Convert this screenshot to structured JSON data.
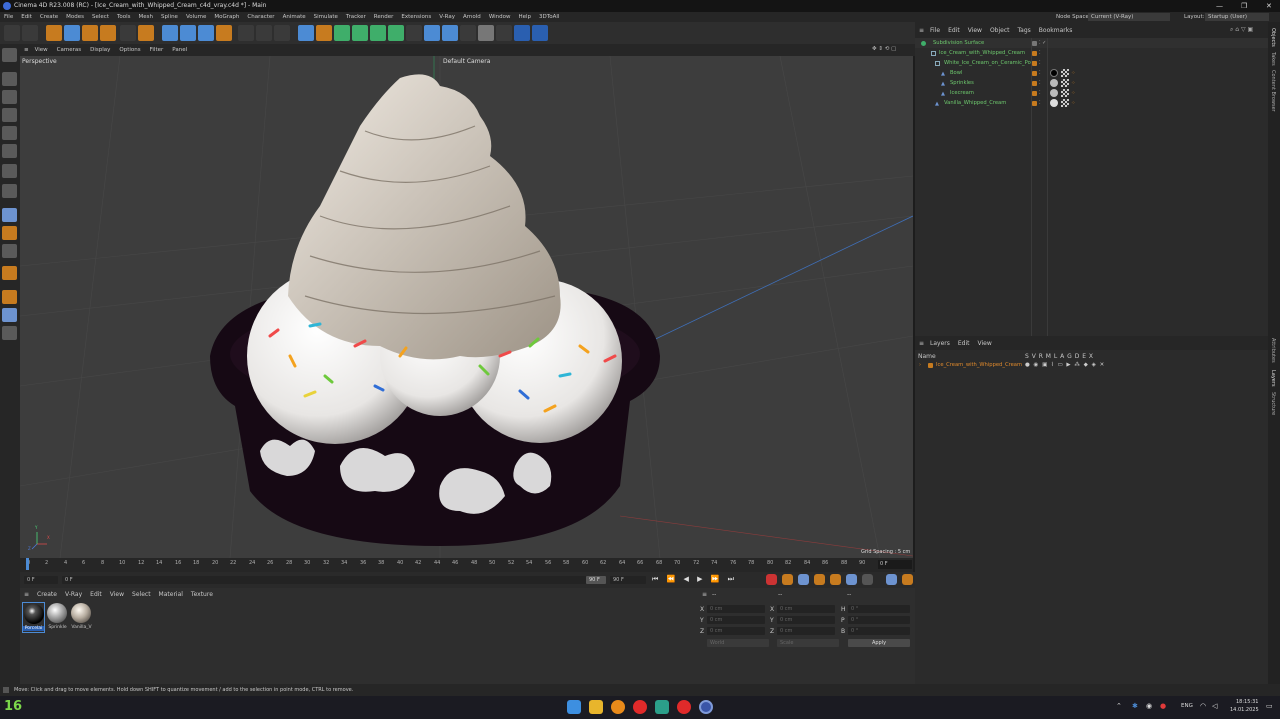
{
  "window": {
    "title": "Cinema 4D R23.008 (RC) - [Ice_Cream_with_Whipped_Cream_c4d_vray.c4d *] - Main"
  },
  "menubar": {
    "items": [
      "File",
      "Edit",
      "Create",
      "Modes",
      "Select",
      "Tools",
      "Mesh",
      "Spline",
      "Volume",
      "MoGraph",
      "Character",
      "Animate",
      "Simulate",
      "Tracker",
      "Render",
      "Extensions",
      "V-Ray",
      "Arnold",
      "Window",
      "Help",
      "3DToAll"
    ],
    "node_space_label": "Node Space:",
    "node_space_value": "Current (V-Ray)",
    "layout_label": "Layout:",
    "layout_value": "Startup (User)"
  },
  "viewport": {
    "menu": [
      "View",
      "Cameras",
      "Display",
      "Options",
      "Filter",
      "Panel"
    ],
    "label": "Perspective",
    "camera": "Default Camera",
    "grid_spacing": "Grid Spacing : 5 cm",
    "axis_x": "X",
    "axis_y": "Y",
    "axis_z": "Z"
  },
  "timeline": {
    "ticks": [
      "0",
      "2",
      "4",
      "6",
      "8",
      "10",
      "12",
      "14",
      "16",
      "18",
      "20",
      "22",
      "24",
      "26",
      "28",
      "30",
      "32",
      "34",
      "36",
      "38",
      "40",
      "42",
      "44",
      "46",
      "48",
      "50",
      "52",
      "54",
      "56",
      "58",
      "60",
      "62",
      "64",
      "66",
      "68",
      "70",
      "72",
      "74",
      "76",
      "78",
      "80",
      "82",
      "84",
      "86",
      "88",
      "90"
    ],
    "current": "0 F"
  },
  "transport": {
    "start": "0 F",
    "current": "0 F",
    "end": "90 F",
    "end2": "90 F"
  },
  "materials": {
    "menu": [
      "Create",
      "V-Ray",
      "Edit",
      "View",
      "Select",
      "Material",
      "Texture"
    ],
    "items": [
      "Porcelai",
      "Sprinkle",
      "Vanilla_V"
    ]
  },
  "attributes": {
    "header": "--",
    "col2": "--",
    "col3": "--",
    "rows": [
      {
        "a": "X",
        "av": "0 cm",
        "b": "X",
        "bv": "0 cm",
        "c": "H",
        "cv": "0 °"
      },
      {
        "a": "Y",
        "av": "0 cm",
        "b": "Y",
        "bv": "0 cm",
        "c": "P",
        "cv": "0 °"
      },
      {
        "a": "Z",
        "av": "0 cm",
        "b": "Z",
        "bv": "0 cm",
        "c": "B",
        "cv": "0 °"
      }
    ],
    "world": "World",
    "scale": "Scale",
    "apply": "Apply"
  },
  "objects": {
    "menu": [
      "File",
      "Edit",
      "View",
      "Object",
      "Tags",
      "Bookmarks"
    ],
    "items": [
      "Subdivision Surface",
      "Ice_Cream_with_Whipped_Cream",
      "White_Ice_Cream_on_Ceramic_Pot",
      "Bowl",
      "Sprinkles",
      "Icecream",
      "Vanilla_Whipped_Cream"
    ]
  },
  "layers": {
    "menu": [
      "Layers",
      "Edit",
      "View"
    ],
    "name_col": "Name",
    "flags": "S V R M L A G D E X",
    "item": "Ice_Cream_with_Whipped_Cream"
  },
  "sidetabs": [
    "Objects",
    "Takes",
    "Content Browser",
    "Attributes",
    "Layers",
    "Structure"
  ],
  "status": {
    "text": "Move: Click and drag to move elements. Hold down SHIFT to quantize movement / add to the selection in point mode, CTRL to remove."
  },
  "taskbar": {
    "badge": "16",
    "lang": "ENG",
    "time": "18:15:31",
    "date": "14.01.2025"
  },
  "colors": {
    "accent": "#c77b1f",
    "select": "#4c8bd4"
  }
}
